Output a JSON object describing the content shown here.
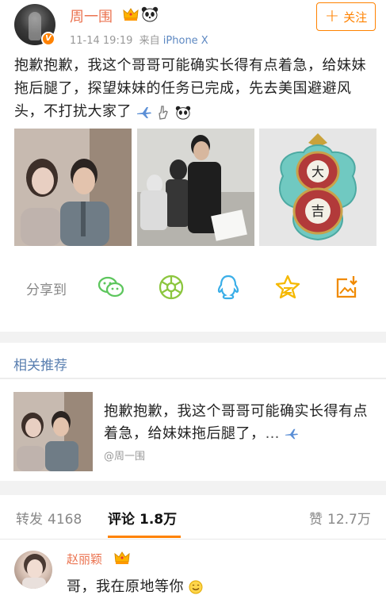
{
  "post": {
    "user_name": "周一围",
    "time": "11-14 19:19",
    "source_prefix": "来自",
    "source_device": "iPhone X",
    "follow_label": "关注",
    "text": "抱歉抱歉，我这个哥哥可能确实长得有点着急，给妹妹拖后腿了，探望妹妹的任务已完成，先去美国避避风头，不打扰大家了",
    "trailing_icons": [
      "airplane-icon",
      "shhh-hand-icon",
      "panda-icon"
    ],
    "photos": [
      "photo-drama-still",
      "photo-behind-scenes",
      "photo-da-ji-ornament"
    ]
  },
  "share": {
    "label": "分享到",
    "targets": [
      "wechat-icon",
      "moments-icon",
      "qq-icon",
      "qzone-icon",
      "save-image-icon"
    ]
  },
  "related": {
    "title": "相关推荐",
    "text": "抱歉抱歉，我这个哥哥可能确实长得有点着急，给妹妹拖后腿了，",
    "source": "@周一围"
  },
  "stats": {
    "repost_label": "转发",
    "repost_count": "4168",
    "comment_label": "评论",
    "comment_count": "1.8万",
    "like_label": "赞",
    "like_count": "12.7万"
  },
  "comment": {
    "user_name": "赵丽颖",
    "text": "哥，我在原地等你"
  },
  "colors": {
    "accent_orange": "#ff8200",
    "username_orange": "#eb7350",
    "link_blue": "#5a7fb0",
    "share_green": "#5dc65d"
  }
}
